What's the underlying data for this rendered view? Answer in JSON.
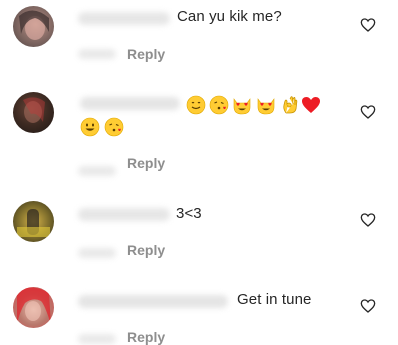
{
  "comments": [
    {
      "text": "Can yu kik me?",
      "reply_label": "Reply"
    },
    {
      "text": "",
      "emojis": [
        "grinning-face-emoji",
        "face-blowing-kiss-emoji",
        "heart-eyes-cat-emoji",
        "heart-eyes-cat-emoji",
        "ok-hand-emoji",
        "red-heart-emoji",
        "grinning-face-emoji",
        "face-blowing-kiss-emoji"
      ],
      "reply_label": "Reply"
    },
    {
      "text": "3<3",
      "reply_label": "Reply"
    },
    {
      "text": "Get in tune",
      "reply_label": "Reply"
    }
  ],
  "icons": {
    "like": "heart-outline-icon"
  },
  "colors": {
    "text": "#262626",
    "secondary": "#8e8e8e",
    "heart_red": "#ed1c24",
    "emoji_yellow": "#ffcc33"
  }
}
